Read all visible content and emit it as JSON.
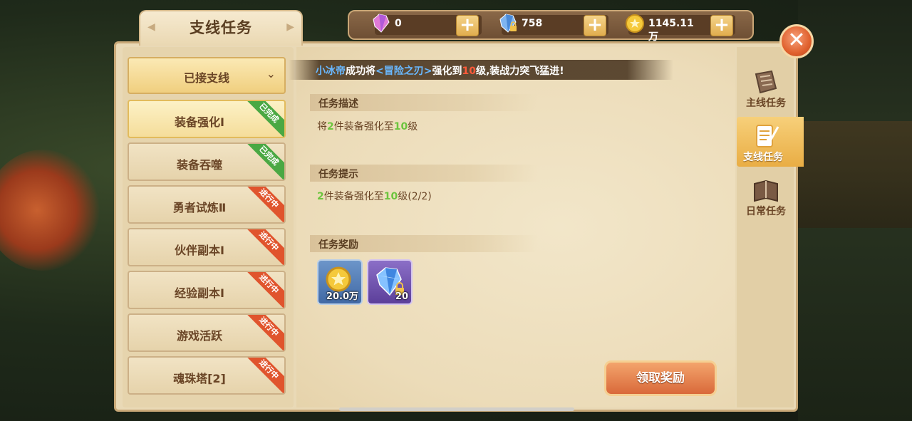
{
  "title": "支线任务",
  "resources": [
    {
      "name": "pink-diamond",
      "value": "0"
    },
    {
      "name": "bound-diamond",
      "value": "758"
    },
    {
      "name": "gold-coin",
      "value": "1145.11万"
    }
  ],
  "close_label": "✕",
  "dropdown_label": "已接支线",
  "quests": [
    {
      "label": "装备强化Ⅰ",
      "status": "已完成",
      "state": "done",
      "selected": true
    },
    {
      "label": "装备吞噬",
      "status": "已完成",
      "state": "done",
      "selected": false
    },
    {
      "label": "勇者试炼Ⅱ",
      "status": "进行中",
      "state": "prog",
      "selected": false
    },
    {
      "label": "伙伴副本Ⅰ",
      "status": "进行中",
      "state": "prog",
      "selected": false
    },
    {
      "label": "经验副本Ⅰ",
      "status": "进行中",
      "state": "prog",
      "selected": false
    },
    {
      "label": "游戏活跃",
      "status": "进行中",
      "state": "prog",
      "selected": false
    },
    {
      "label": "魂珠塔[2]",
      "status": "进行中",
      "state": "prog",
      "selected": false
    }
  ],
  "broadcast": {
    "player": "小冰帝",
    "text1": "成功将",
    "item": "<冒险之刃>",
    "text2": "强化到",
    "level": "10",
    "text3": "级,装战力突飞猛进!"
  },
  "sections": {
    "description": {
      "title": "任务描述",
      "pre": "将",
      "n1": "2",
      "mid": "件装备强化至",
      "n2": "10",
      "post": "级"
    },
    "hint": {
      "title": "任务提示",
      "n1": "2",
      "mid": "件装备强化至",
      "n2": "10",
      "post": "级(2/2)"
    },
    "reward": {
      "title": "任务奖励"
    }
  },
  "rewards": [
    {
      "type": "coin",
      "amount": "20.0万"
    },
    {
      "type": "bound-diamond",
      "amount": "20"
    }
  ],
  "claim_label": "领取奖励",
  "right_tabs": [
    {
      "label": "主线任务",
      "icon": "main-quest-icon",
      "active": false
    },
    {
      "label": "支线任务",
      "icon": "side-quest-icon",
      "active": true
    },
    {
      "label": "日常任务",
      "icon": "daily-quest-icon",
      "active": false
    }
  ],
  "colors": {
    "accent": "#e0542d",
    "done": "#4aa843",
    "highlight_number": "#6cc43e"
  }
}
